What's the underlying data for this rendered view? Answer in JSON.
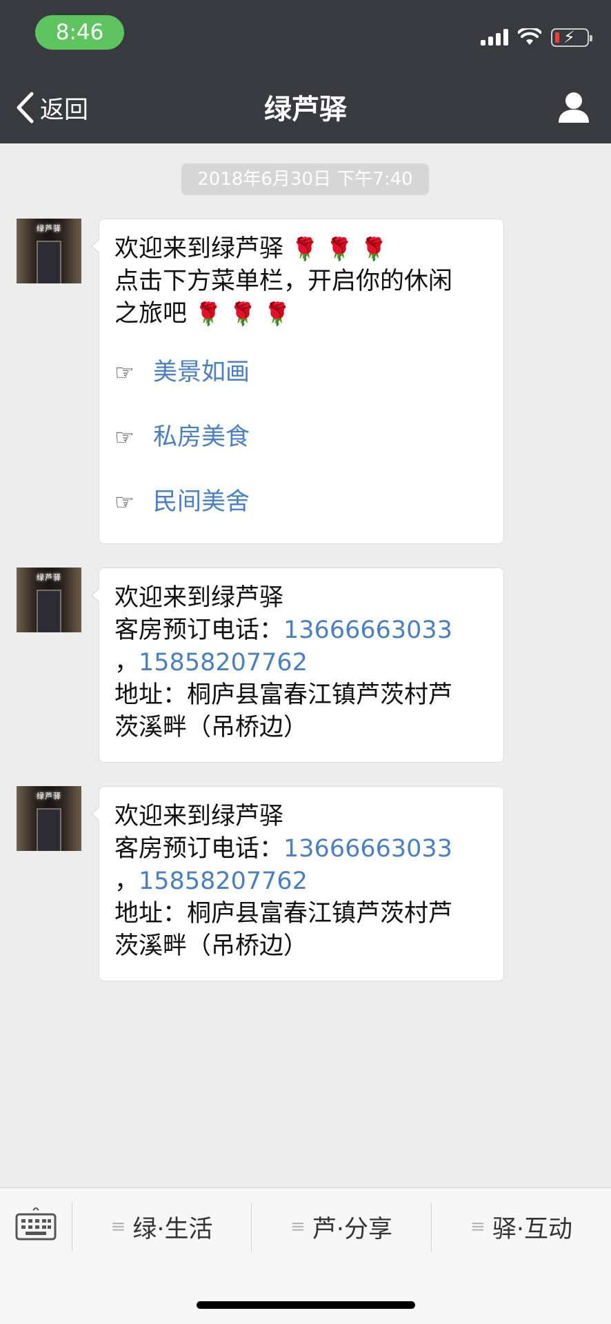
{
  "status_bar": {
    "time": "8:46"
  },
  "nav": {
    "back_label": "返回",
    "title": "绿芦驿"
  },
  "chat": {
    "timestamp": "2018年6月30日 下午7:40",
    "avatar_sign": "绿芦驿",
    "messages": [
      {
        "line1": "欢迎来到绿芦驿",
        "roses": "🌹 🌹 🌹",
        "line2": "点击下方菜单栏，开启你的休闲",
        "line3": "之旅吧",
        "pointer": "☞",
        "links": [
          "美景如画",
          "私房美食",
          "民间美舍"
        ]
      },
      {
        "line1": "欢迎来到绿芦驿",
        "phone_label": "客房预订电话：",
        "phone1": "13666663033",
        "comma": "，",
        "phone2": "15858207762",
        "address1": "地址：桐庐县富春江镇芦茨村芦",
        "address2": "茨溪畔（吊桥边）"
      },
      {
        "line1": "欢迎来到绿芦驿",
        "phone_label": "客房预订电话：",
        "phone1": "13666663033",
        "comma": "，",
        "phone2": "15858207762",
        "address1": "地址：桐庐县富春江镇芦茨村芦",
        "address2": "茨溪畔（吊桥边）"
      }
    ]
  },
  "bottom_menu": {
    "menu_icon": "≡",
    "items": [
      "绿·生活",
      "芦·分享",
      "驿·互动"
    ]
  }
}
